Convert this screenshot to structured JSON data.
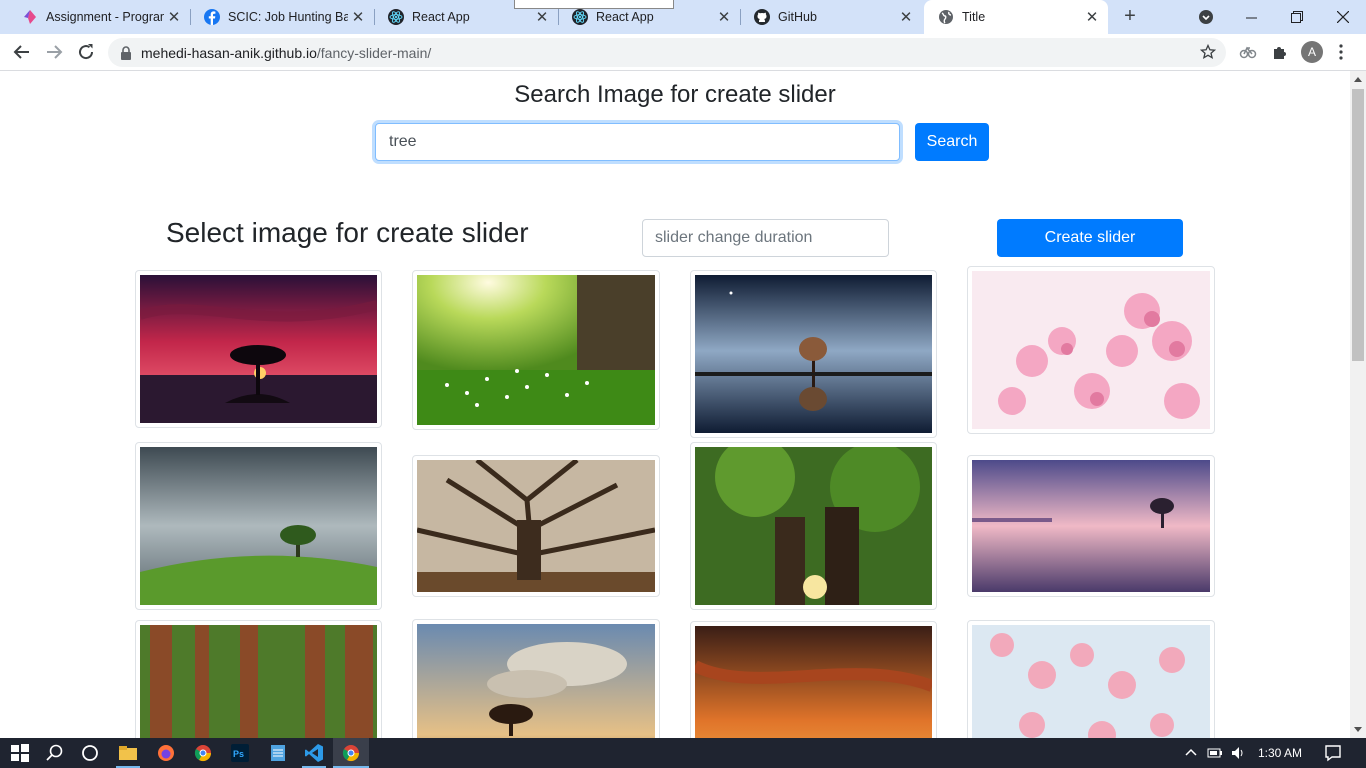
{
  "browser": {
    "tabs": [
      {
        "title": "Assignment - Program",
        "icon": "program-hub-icon"
      },
      {
        "title": "SCIC: Job Hunting Batt",
        "icon": "facebook-icon"
      },
      {
        "title": "React App",
        "icon": "react-icon"
      },
      {
        "title": "React App",
        "icon": "react-icon"
      },
      {
        "title": "GitHub",
        "icon": "github-icon"
      },
      {
        "title": "Title",
        "icon": "globe-icon"
      }
    ],
    "url_host": "mehedi-hasan-anik.github.io",
    "url_path": "/fancy-slider-main/",
    "avatar_letter": "A"
  },
  "page": {
    "search_heading": "Search Image for create slider",
    "search_value": "tree",
    "search_button": "Search",
    "select_heading": "Select image for create slider",
    "duration_placeholder": "slider change duration",
    "create_button": "Create slider"
  },
  "images": [
    {
      "name": "red-sky-tree"
    },
    {
      "name": "sunlit-meadow"
    },
    {
      "name": "tree-reflection-night"
    },
    {
      "name": "pink-blossom"
    },
    {
      "name": "storm-tree-hill"
    },
    {
      "name": "bare-tree-roots"
    },
    {
      "name": "green-forest-tree"
    },
    {
      "name": "purple-lake-tree"
    },
    {
      "name": "redwood-forest"
    },
    {
      "name": "cloud-sunset-tree"
    },
    {
      "name": "orange-sunset-sky"
    },
    {
      "name": "cherry-blossom-sky"
    }
  ],
  "taskbar": {
    "time": "1:30 AM"
  },
  "colors": {
    "primary": "#007bff",
    "tabstrip": "#d3e2f9",
    "taskbar": "#1f2430"
  }
}
